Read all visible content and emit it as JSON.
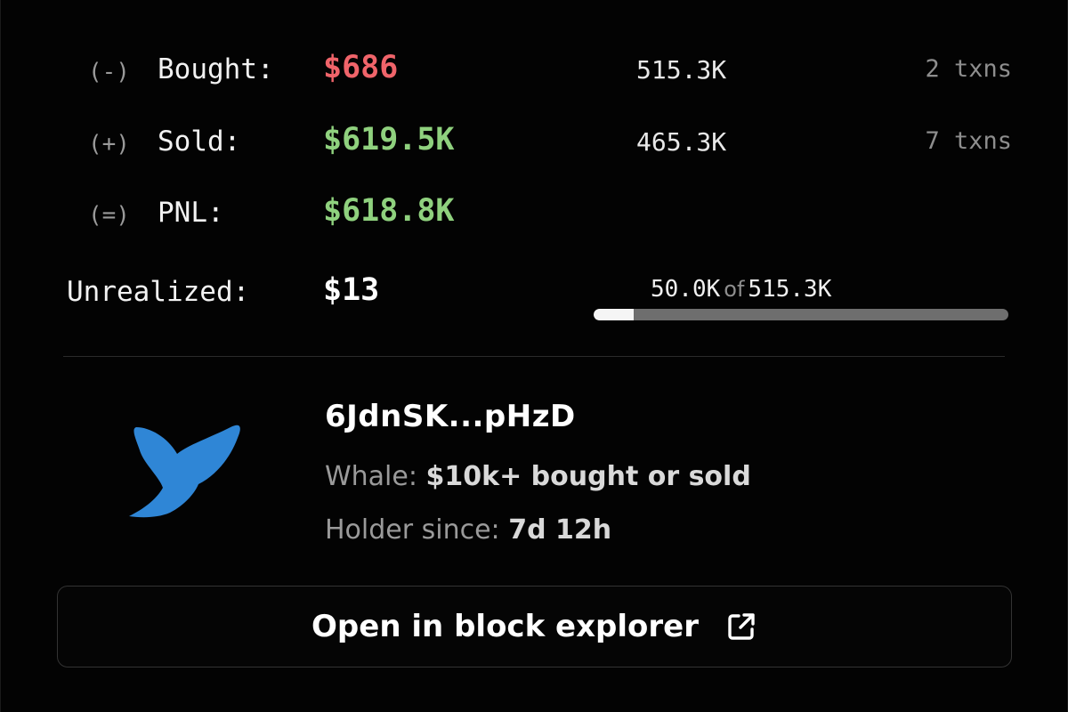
{
  "trades": [
    {
      "sign": "(-)",
      "label": "Bought:",
      "amount": "$686",
      "tokens": "515.3K",
      "txns": "2 txns",
      "tone": "negative"
    },
    {
      "sign": "(+)",
      "label": "Sold:",
      "amount": "$619.5K",
      "tokens": "465.3K",
      "txns": "7 txns",
      "tone": "positive"
    },
    {
      "sign": "(=)",
      "label": "PNL:",
      "amount": "$618.8K",
      "tone": "positive"
    }
  ],
  "unrealized": {
    "label": "Unrealized:",
    "value": "$13",
    "held": "50.0K",
    "of_word": "of",
    "total": "515.3K",
    "progress_fraction": 0.097
  },
  "wallet": {
    "address": "6JdnSK...pHzD",
    "icon": "whale-tail-icon",
    "whale_label": "Whale:",
    "whale_value": "$10k+ bought or sold",
    "holder_label": "Holder since:",
    "holder_value": "7d 12h"
  },
  "actions": {
    "open_explorer_label": "Open in block explorer",
    "open_explorer_icon": "external-link-icon"
  },
  "colors": {
    "negative": "#f0646a",
    "positive": "#8fd17e",
    "whale_blue": "#2f86d6"
  }
}
